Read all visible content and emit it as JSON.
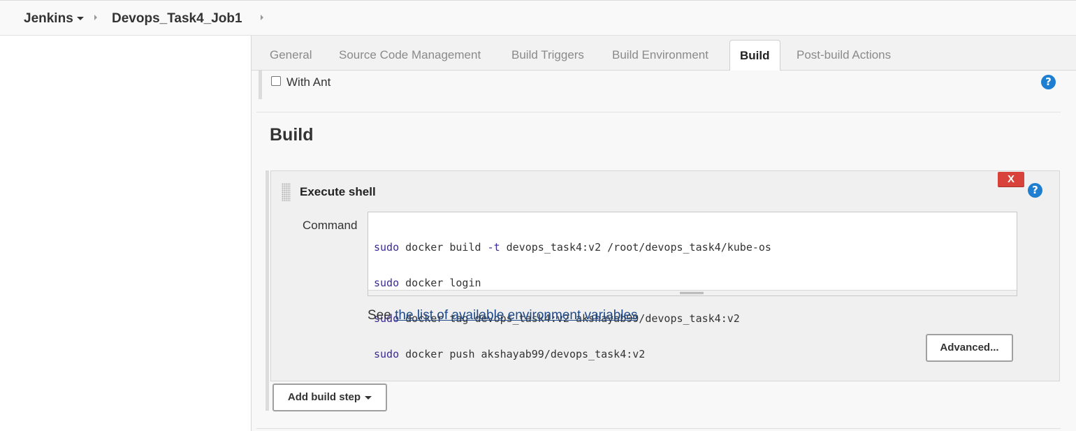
{
  "breadcrumb": {
    "root": "Jenkins",
    "job": "Devops_Task4_Job1"
  },
  "tabs": [
    {
      "label": "General"
    },
    {
      "label": "Source Code Management"
    },
    {
      "label": "Build Triggers"
    },
    {
      "label": "Build Environment"
    },
    {
      "label": "Build",
      "active": true
    },
    {
      "label": "Post-build Actions"
    }
  ],
  "ant": {
    "label": "With Ant",
    "checked": false
  },
  "help_symbol": "?",
  "build_section": {
    "title": "Build",
    "step": {
      "title": "Execute shell",
      "delete_label": "X",
      "command_label": "Command",
      "command_lines": [
        {
          "kw": "sudo",
          "rest": " docker build ",
          "flag": "-t",
          "rest2": " devops_task4:v2 /root/devops_task4/kube-os"
        },
        {
          "kw": "sudo",
          "rest": " docker login",
          "flag": "",
          "rest2": ""
        },
        {
          "kw": "sudo",
          "rest": " docker tag devops_task4:v2 akshayab99/devops_task4:v2",
          "flag": "",
          "rest2": ""
        },
        {
          "kw": "sudo",
          "rest": " docker push akshayab99/devops_task4:v2",
          "flag": "",
          "rest2": ""
        }
      ],
      "env_prefix": "See ",
      "env_link": "the list of available environment variables",
      "advanced_label": "Advanced..."
    },
    "add_step_label": "Add build step"
  },
  "colors": {
    "help_blue": "#1e7ed0",
    "delete_red": "#d9423a",
    "link": "#204a87",
    "keyword": "#3a2a94"
  }
}
